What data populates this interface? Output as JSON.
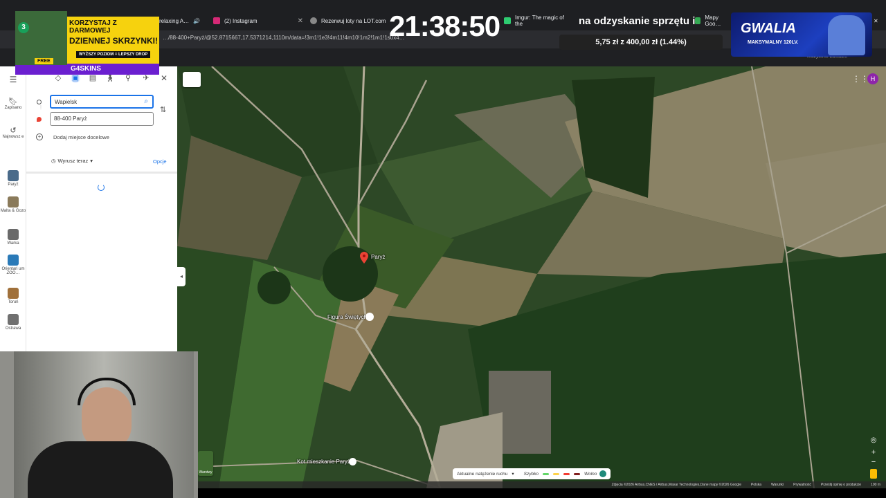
{
  "browser": {
    "tabs": [
      {
        "label": "relaxing A…",
        "color": "#c00"
      },
      {
        "label": "(2) Instagram",
        "color": "#d62976"
      },
      {
        "label": "Rezerwuj loty na LOT.com",
        "color": "#888"
      },
      {
        "label": "Imgur: The magic of the",
        "color": "#2ecc71"
      },
      {
        "label": "Mapy Goo…",
        "color": "#34a853"
      }
    ],
    "url": "…/88-400+Paryż/@52.8715667,17.5371214,1110m/data=!3m1!1e3!4m11!4m10!1m2!1m1!1s0x4…",
    "bookmarks_label": "Wszystkie zakładki"
  },
  "directions": {
    "origin_value": "Wapielsk",
    "destination_value": "88-400 Paryż",
    "add_destination": "Dodaj miejsce docelowe",
    "depart_label": "Wyrusz teraz",
    "options_label": "Opcje"
  },
  "sidebar": {
    "saved_label": "Zapisano",
    "recent_label": "Najnowsz e",
    "recents": [
      {
        "label": "Paryż",
        "color": "#4a6b8a"
      },
      {
        "label": "Malta & Gozo",
        "color": "#8a7a5a"
      },
      {
        "label": "Warka",
        "color": "#6a6a6a"
      },
      {
        "label": "Orientari um ZOO…",
        "color": "#2a7ab8"
      },
      {
        "label": "Toruń",
        "color": "#a0703a"
      },
      {
        "label": "Ostrawa",
        "color": "#707070"
      }
    ]
  },
  "map": {
    "places": {
      "pin": "Paryż",
      "shrine": "Figura Świętych",
      "cats": "Kot mieszkanie Paryż"
    },
    "layers_label": "Warstwy",
    "traffic": {
      "label": "Aktualne natężenie ruchu",
      "fast": "Szybko",
      "slow": "Wolno",
      "colors": [
        "#63d668",
        "#ffd24a",
        "#f23c32",
        "#811f1f"
      ]
    },
    "footer": [
      "Zdjęcia ©2026 Airbus,CNES / Airbus,Maxar Technologies,Dane mapy ©2026 Google",
      "Polska",
      "Warunki",
      "Prywatność",
      "Prześlij opinię o produkcie",
      "100 m"
    ],
    "user_initial": "H"
  },
  "overlay": {
    "promo_line1": "KORZYSTAJ Z DARMOWEJ",
    "promo_line2": "DZIENNEJ SKRZYNKI!",
    "promo_line3": "WYŻSZY POZIOM = LEPSZY DROP",
    "promo_badge": "3",
    "promo_free": "FREE",
    "promo_brand": "G4SKINS",
    "clock": "21:38:50",
    "goal_text": "na odzyskanie sprzętu i",
    "goal_progress": "5,75 zł z 400,00 zł (1.44%)",
    "gwalia_title": "GWALIA",
    "gwalia_sub": "MAKSYMALNY 120LV."
  }
}
